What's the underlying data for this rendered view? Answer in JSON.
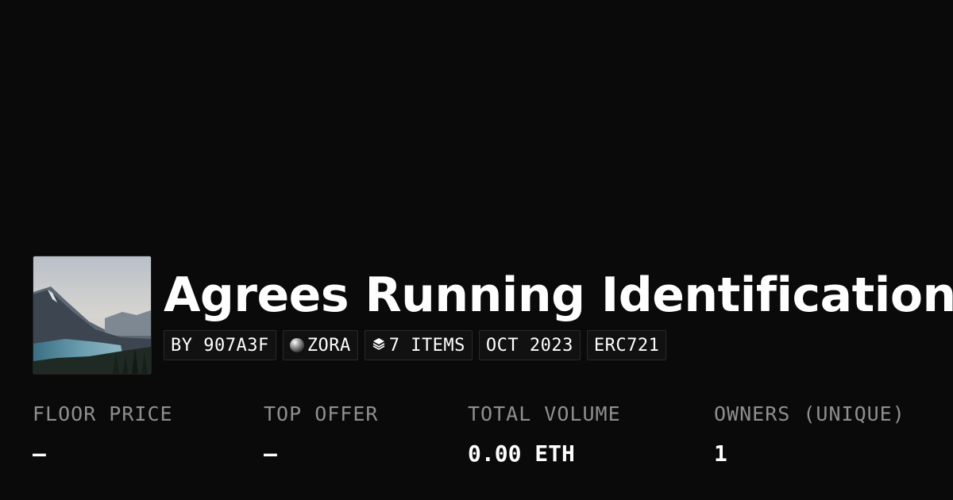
{
  "collection": {
    "thumbnail_icon": "landscape-thumbnail",
    "title": "Agrees Running Identification",
    "tags": {
      "creator": "BY 907A3F",
      "network": "ZORA",
      "network_icon": "zora-orb-icon",
      "items": "7 ITEMS",
      "items_icon": "layers-icon",
      "date": "OCT 2023",
      "standard": "ERC721"
    }
  },
  "stats": [
    {
      "label": "FLOOR PRICE",
      "value": "–"
    },
    {
      "label": "TOP OFFER",
      "value": "–"
    },
    {
      "label": "TOTAL VOLUME",
      "value": "0.00 ETH"
    },
    {
      "label": "OWNERS (UNIQUE)",
      "value": "1"
    }
  ],
  "colors": {
    "background": "#0a0a0a",
    "text": "#ffffff",
    "label": "#8f8f8f"
  }
}
